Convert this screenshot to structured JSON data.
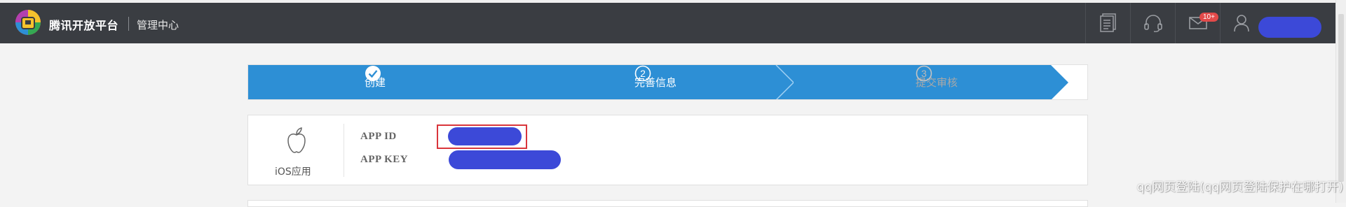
{
  "header": {
    "brand": "腾讯开放平台",
    "section": "管理中心",
    "message_badge": "10+",
    "icons": [
      "docs-icon",
      "support-headset-icon",
      "mail-icon",
      "user-icon"
    ]
  },
  "steps": [
    {
      "label": "创建",
      "status": "done"
    },
    {
      "label": "完善信息",
      "status": "active",
      "number": "2"
    },
    {
      "label": "提交审核",
      "status": "pending",
      "number": "3"
    }
  ],
  "app": {
    "platform_label": "iOS应用",
    "platform_icon": "apple-icon",
    "fields": [
      {
        "label": "APP ID",
        "value": "[redacted]"
      },
      {
        "label": "APP KEY",
        "value": "[redacted]"
      }
    ]
  },
  "watermark": "qq网页登陆(qq网页登陆保护在哪打开)",
  "colors": {
    "topbar": "#3a3d42",
    "step_active": "#2d8fd5",
    "redaction": "#3c49d8",
    "highlight": "#d9353b"
  }
}
